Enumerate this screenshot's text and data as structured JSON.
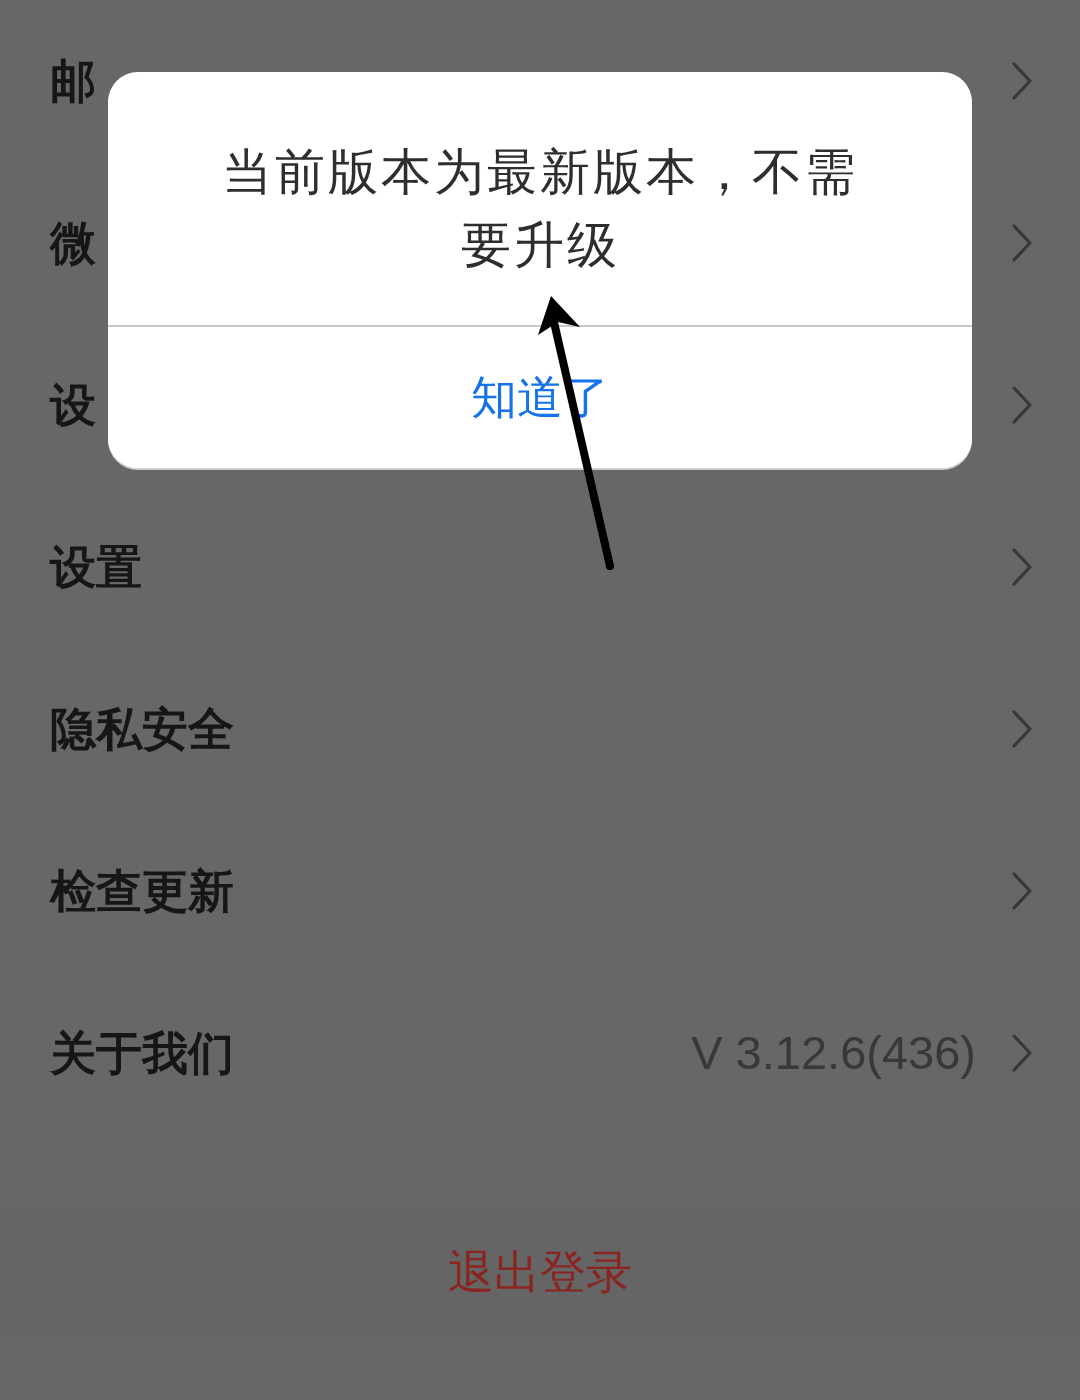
{
  "settings": {
    "rows": [
      {
        "label": "邮"
      },
      {
        "label": "微"
      },
      {
        "label": "设"
      },
      {
        "label": "设置"
      },
      {
        "label": "隐私安全"
      },
      {
        "label": "检查更新"
      },
      {
        "label": "关于我们",
        "value": "V 3.12.6(436)"
      }
    ]
  },
  "logout_button": {
    "label": "退出登录"
  },
  "dialog": {
    "message": "当前版本为最新版本，不需要升级",
    "button": "知道了"
  }
}
